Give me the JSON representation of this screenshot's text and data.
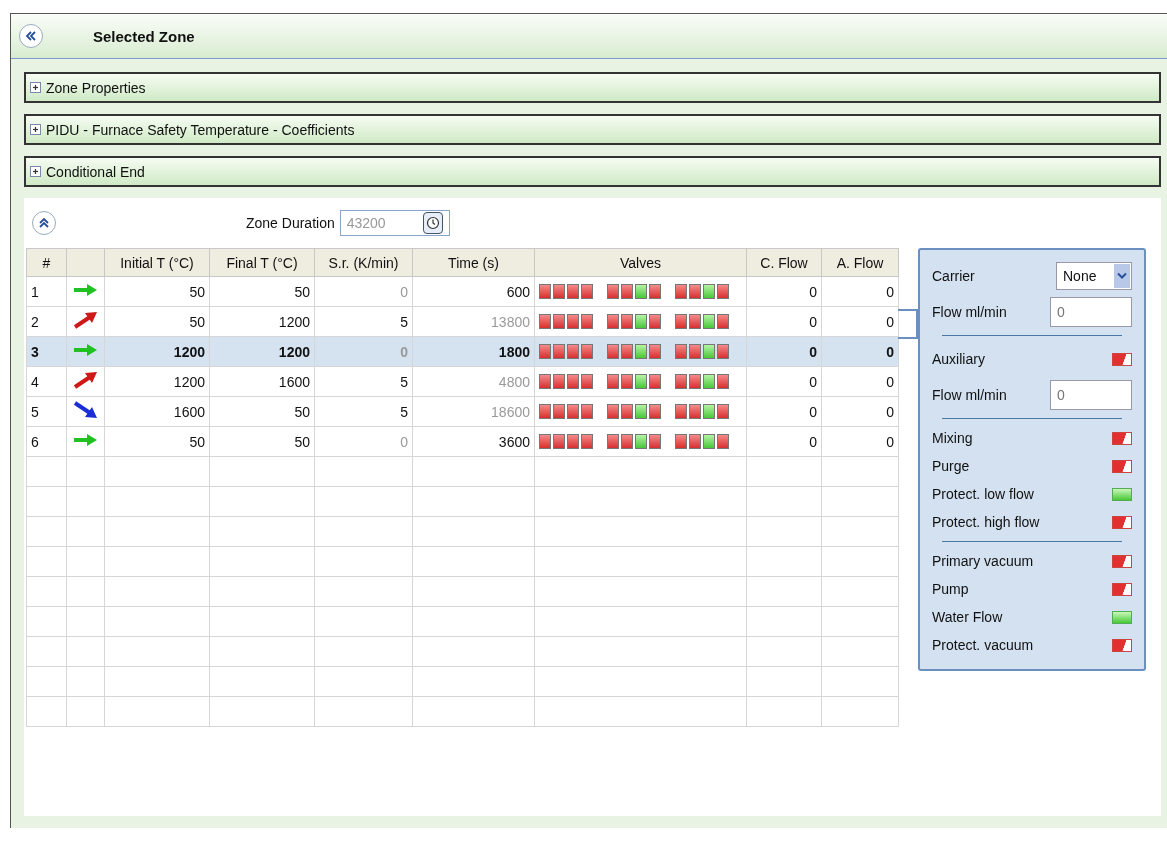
{
  "header": {
    "title": "Selected Zone"
  },
  "sections": [
    {
      "label": "Zone Properties",
      "expanded": false
    },
    {
      "label": "PIDU - Furnace Safety Temperature - Coefficients",
      "expanded": false
    },
    {
      "label": "Conditional End",
      "expanded": false
    }
  ],
  "zone_duration": {
    "label": "Zone Duration",
    "value": "43200"
  },
  "table": {
    "columns": [
      "#",
      "Initial T (°C)",
      "Final T (°C)",
      "S.r. (K/min)",
      "Time (s)",
      "Valves",
      "C. Flow",
      "A. Flow"
    ],
    "rows": [
      {
        "index": "1",
        "kind": "flat",
        "initial": "50",
        "final": "50",
        "rate": "0",
        "rate_dimmed": true,
        "time": "600",
        "time_dimmed": false,
        "valves": [
          [
            false,
            false,
            false,
            false
          ],
          [
            false,
            false,
            true,
            false
          ],
          [
            false,
            false,
            true,
            false
          ]
        ],
        "c_flow": "0",
        "a_flow": "0",
        "selected": false
      },
      {
        "index": "2",
        "kind": "up",
        "initial": "50",
        "final": "1200",
        "rate": "5",
        "rate_dimmed": false,
        "time": "13800",
        "time_dimmed": true,
        "valves": [
          [
            false,
            false,
            false,
            false
          ],
          [
            false,
            false,
            true,
            false
          ],
          [
            false,
            false,
            true,
            false
          ]
        ],
        "c_flow": "0",
        "a_flow": "0",
        "selected": false
      },
      {
        "index": "3",
        "kind": "flat",
        "initial": "1200",
        "final": "1200",
        "rate": "0",
        "rate_dimmed": true,
        "time": "1800",
        "time_dimmed": false,
        "valves": [
          [
            false,
            false,
            false,
            false
          ],
          [
            false,
            false,
            true,
            false
          ],
          [
            false,
            false,
            true,
            false
          ]
        ],
        "c_flow": "0",
        "a_flow": "0",
        "selected": true
      },
      {
        "index": "4",
        "kind": "up",
        "initial": "1200",
        "final": "1600",
        "rate": "5",
        "rate_dimmed": false,
        "time": "4800",
        "time_dimmed": true,
        "valves": [
          [
            false,
            false,
            false,
            false
          ],
          [
            false,
            false,
            true,
            false
          ],
          [
            false,
            false,
            true,
            false
          ]
        ],
        "c_flow": "0",
        "a_flow": "0",
        "selected": false
      },
      {
        "index": "5",
        "kind": "down",
        "initial": "1600",
        "final": "50",
        "rate": "5",
        "rate_dimmed": false,
        "time": "18600",
        "time_dimmed": true,
        "valves": [
          [
            false,
            false,
            false,
            false
          ],
          [
            false,
            false,
            true,
            false
          ],
          [
            false,
            false,
            true,
            false
          ]
        ],
        "c_flow": "0",
        "a_flow": "0",
        "selected": false
      },
      {
        "index": "6",
        "kind": "flat",
        "initial": "50",
        "final": "50",
        "rate": "0",
        "rate_dimmed": true,
        "time": "3600",
        "time_dimmed": false,
        "valves": [
          [
            false,
            false,
            false,
            false
          ],
          [
            false,
            false,
            true,
            false
          ],
          [
            false,
            false,
            true,
            false
          ]
        ],
        "c_flow": "0",
        "a_flow": "0",
        "selected": false
      }
    ]
  },
  "panel": {
    "carrier": {
      "label": "Carrier",
      "value": "None",
      "flow_label": "Flow ml/min",
      "flow_placeholder": "0"
    },
    "auxiliary": {
      "label": "Auxiliary",
      "on": false,
      "flow_label": "Flow ml/min",
      "flow_placeholder": "0"
    },
    "groups": [
      [
        {
          "label": "Mixing",
          "on": false
        },
        {
          "label": "Purge",
          "on": false
        },
        {
          "label": "Protect. low flow",
          "on": true
        },
        {
          "label": "Protect. high flow",
          "on": false
        }
      ],
      [
        {
          "label": "Primary vacuum",
          "on": false
        },
        {
          "label": "Pump",
          "on": false
        },
        {
          "label": "Water Flow",
          "on": true
        },
        {
          "label": "Protect. vacuum",
          "on": false
        }
      ]
    ]
  }
}
